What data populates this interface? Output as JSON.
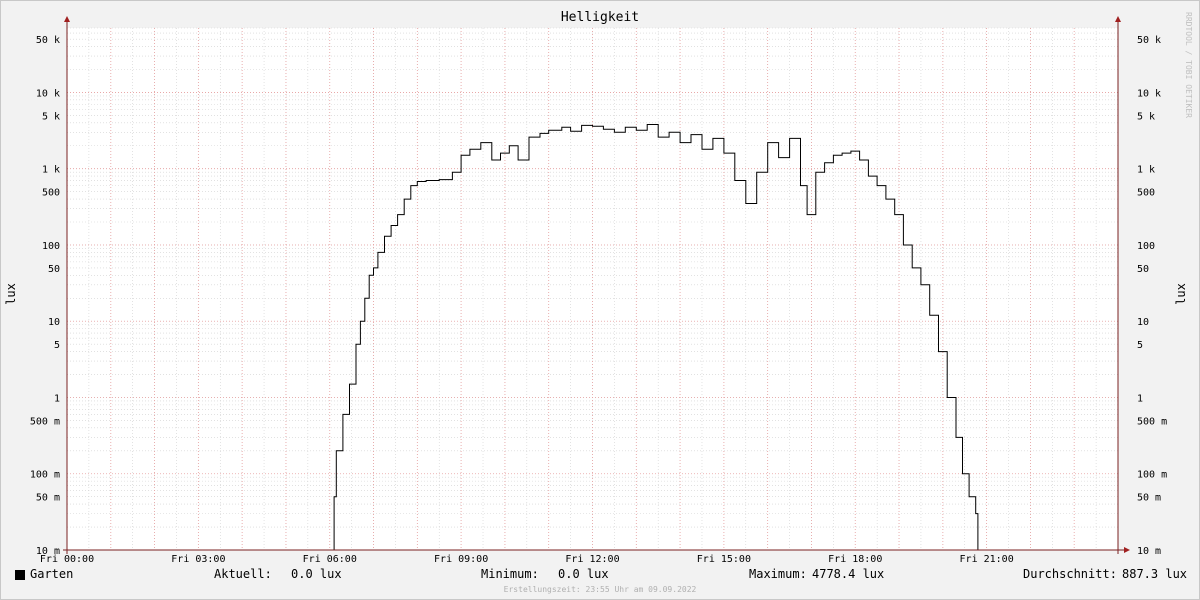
{
  "brand": {
    "watermark": "RRDTOOL / TOBI OETIKER"
  },
  "colors": {
    "line": "#000000",
    "grid_major": "#e8a0a0",
    "grid_minor": "#d0d0d0",
    "axis": "#7a2020",
    "background": "#ffffff"
  },
  "chart_data": {
    "type": "line",
    "title": "Helligkeit",
    "ylabel": "lux",
    "yscale": "log",
    "ylim": [
      0.01,
      70000
    ],
    "xlim": [
      0,
      24
    ],
    "x_unit": "hours",
    "x_ticks": [
      {
        "v": 0,
        "label": "Fri 00:00"
      },
      {
        "v": 3,
        "label": "Fri 03:00"
      },
      {
        "v": 6,
        "label": "Fri 06:00"
      },
      {
        "v": 9,
        "label": "Fri 09:00"
      },
      {
        "v": 12,
        "label": "Fri 12:00"
      },
      {
        "v": 15,
        "label": "Fri 15:00"
      },
      {
        "v": 18,
        "label": "Fri 18:00"
      },
      {
        "v": 21,
        "label": "Fri 21:00"
      }
    ],
    "y_ticks": [
      {
        "v": 0.01,
        "label": "10 m"
      },
      {
        "v": 0.05,
        "label": "50 m"
      },
      {
        "v": 0.1,
        "label": "100 m"
      },
      {
        "v": 0.5,
        "label": "500 m"
      },
      {
        "v": 1,
        "label": "1"
      },
      {
        "v": 5,
        "label": "5"
      },
      {
        "v": 10,
        "label": "10"
      },
      {
        "v": 50,
        "label": "50"
      },
      {
        "v": 100,
        "label": "100"
      },
      {
        "v": 500,
        "label": "500"
      },
      {
        "v": 1000,
        "label": "1 k"
      },
      {
        "v": 5000,
        "label": "5 k"
      },
      {
        "v": 10000,
        "label": "10 k"
      },
      {
        "v": 50000,
        "label": "50 k"
      }
    ],
    "grid": true,
    "series": [
      {
        "name": "Garten",
        "x": [
          0,
          6.1,
          6.15,
          6.3,
          6.45,
          6.6,
          6.7,
          6.8,
          6.9,
          7.0,
          7.1,
          7.25,
          7.4,
          7.55,
          7.7,
          7.85,
          8.0,
          8.2,
          8.5,
          8.8,
          9.0,
          9.2,
          9.45,
          9.7,
          9.9,
          10.1,
          10.3,
          10.55,
          10.8,
          11.0,
          11.3,
          11.5,
          11.75,
          12.0,
          12.25,
          12.5,
          12.75,
          13.0,
          13.25,
          13.5,
          13.75,
          14.0,
          14.25,
          14.5,
          14.75,
          15.0,
          15.25,
          15.5,
          15.75,
          16.0,
          16.25,
          16.5,
          16.75,
          16.9,
          17.1,
          17.3,
          17.5,
          17.7,
          17.9,
          18.1,
          18.3,
          18.5,
          18.7,
          18.9,
          19.1,
          19.3,
          19.5,
          19.7,
          19.9,
          20.1,
          20.3,
          20.45,
          20.6,
          20.7,
          20.75,
          20.8
        ],
        "y": [
          0.01,
          0.05,
          0.2,
          0.6,
          1.5,
          5,
          10,
          20,
          40,
          50,
          80,
          130,
          180,
          250,
          400,
          600,
          680,
          700,
          720,
          900,
          1500,
          1800,
          2200,
          1300,
          1600,
          2000,
          1300,
          2600,
          2900,
          3200,
          3500,
          3100,
          3700,
          3600,
          3300,
          3000,
          3500,
          3200,
          3800,
          2600,
          3000,
          2200,
          2800,
          1800,
          2500,
          1600,
          700,
          350,
          900,
          2200,
          1400,
          2500,
          600,
          250,
          900,
          1200,
          1500,
          1600,
          1700,
          1300,
          800,
          600,
          400,
          250,
          100,
          50,
          30,
          12,
          4,
          1,
          0.3,
          0.1,
          0.05,
          0.05,
          0.03,
          0.01
        ]
      }
    ],
    "legend": {
      "entry": "Garten",
      "current_label": "Aktuell:",
      "current_value": "0.0 lux",
      "min_label": "Minimum:",
      "min_value": "0.0 lux",
      "max_label": "Maximum:",
      "max_value": "4778.4 lux",
      "avg_label": "Durchschnitt:",
      "avg_value": "887.3 lux"
    },
    "footer": "Erstellungszeit: 23:55 Uhr am 09.09.2022"
  }
}
